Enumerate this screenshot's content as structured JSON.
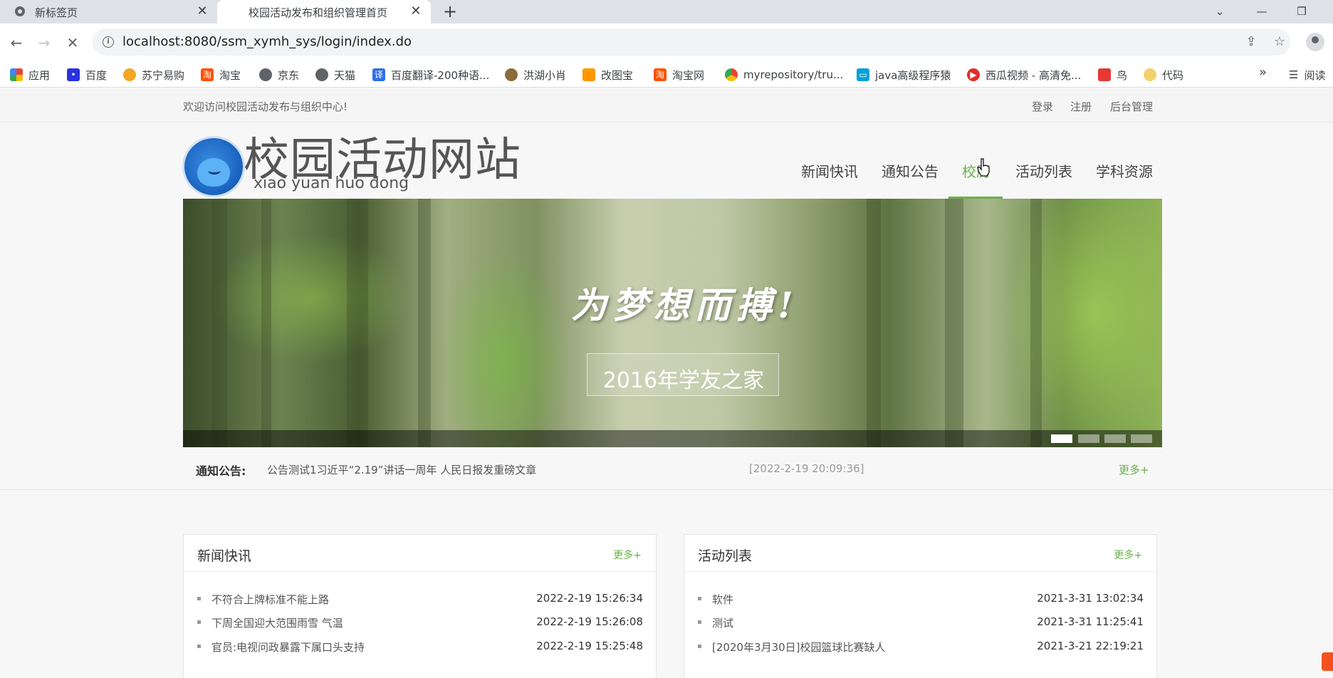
{
  "browser": {
    "tabs": [
      {
        "title": "新标签页",
        "active": false
      },
      {
        "title": "校园活动发布和组织管理首页",
        "active": true
      }
    ],
    "url": "localhost:8080/ssm_xymh_sys/login/index.do",
    "bookmarks": [
      {
        "label": "应用",
        "icon": "apps-grid-icon",
        "color": "#ea4335"
      },
      {
        "label": "百度",
        "icon": "baidu-paw-icon",
        "color": "#2932e1"
      },
      {
        "label": "苏宁易购",
        "icon": "suning-lion-icon",
        "color": "#f5a623"
      },
      {
        "label": "淘宝",
        "icon": "taobao-icon",
        "color": "#ff5000"
      },
      {
        "label": "京东",
        "icon": "globe-icon",
        "color": "#5f6368"
      },
      {
        "label": "天猫",
        "icon": "globe-icon",
        "color": "#5f6368"
      },
      {
        "label": "百度翻译-200种语...",
        "icon": "translate-icon",
        "color": "#2f6fe4"
      },
      {
        "label": "洪湖小肖",
        "icon": "bird-icon",
        "color": "#8a6d3b"
      },
      {
        "label": "改图宝",
        "icon": "gaitubao-icon",
        "color": "#ff9800"
      },
      {
        "label": "淘宝网",
        "icon": "taobao-icon",
        "color": "#ff5000"
      },
      {
        "label": "myrepository/tru...",
        "icon": "chrome-icon",
        "color": "#34a853"
      },
      {
        "label": "java高级程序猿",
        "icon": "bilibili-icon",
        "color": "#00a1d6"
      },
      {
        "label": "西瓜视频 - 高清免...",
        "icon": "xigua-play-icon",
        "color": "#e02e24"
      },
      {
        "label": "鸟",
        "icon": "bird-red-icon",
        "color": "#e53935"
      },
      {
        "label": "代码",
        "icon": "code-leaf-icon",
        "color": "#f2d16b"
      }
    ],
    "bookmarks_more": "»",
    "reader_label": "阅读"
  },
  "site": {
    "welcome": "欢迎访问校园活动发布与组织中心!",
    "top_links": {
      "login": "登录",
      "register": "注册",
      "admin": "后台管理"
    },
    "logo_title": "校园活动网站",
    "logo_subtitle": "xiao yuan huo dong",
    "nav": [
      {
        "label": "新闻快讯",
        "active": false
      },
      {
        "label": "通知公告",
        "active": false
      },
      {
        "label": "校历",
        "active": true
      },
      {
        "label": "活动列表",
        "active": false
      },
      {
        "label": "学科资源",
        "active": false
      }
    ],
    "accent_color": "#6ab04c",
    "banner": {
      "slogan": "为梦想而搏!",
      "caption": "2016年学友之家",
      "slides": 4,
      "active_slide": 1
    },
    "notice": {
      "label": "通知公告:",
      "text": "公告测试1习近平“2.19”讲话一周年 人民日报发重磅文章",
      "date": "[2022-2-19 20:09:36]",
      "more": "更多+"
    },
    "news_panel": {
      "title": "新闻快讯",
      "more": "更多+",
      "items": [
        {
          "title": "不符合上牌标准不能上路",
          "date": "2022-2-19 15:26:34"
        },
        {
          "title": "下周全国迎大范围雨雪 气温",
          "date": "2022-2-19 15:26:08"
        },
        {
          "title": "官员:电视问政暴露下属口头支持",
          "date": "2022-2-19 15:25:48"
        }
      ]
    },
    "activity_panel": {
      "title": "活动列表",
      "more": "更多+",
      "items": [
        {
          "title": "软件",
          "date": "2021-3-31 13:02:34"
        },
        {
          "title": "测试",
          "date": "2021-3-31 11:25:41"
        },
        {
          "title": "[2020年3月30日]校园篮球比赛缺人",
          "date": "2021-3-21 22:19:21"
        }
      ]
    }
  }
}
